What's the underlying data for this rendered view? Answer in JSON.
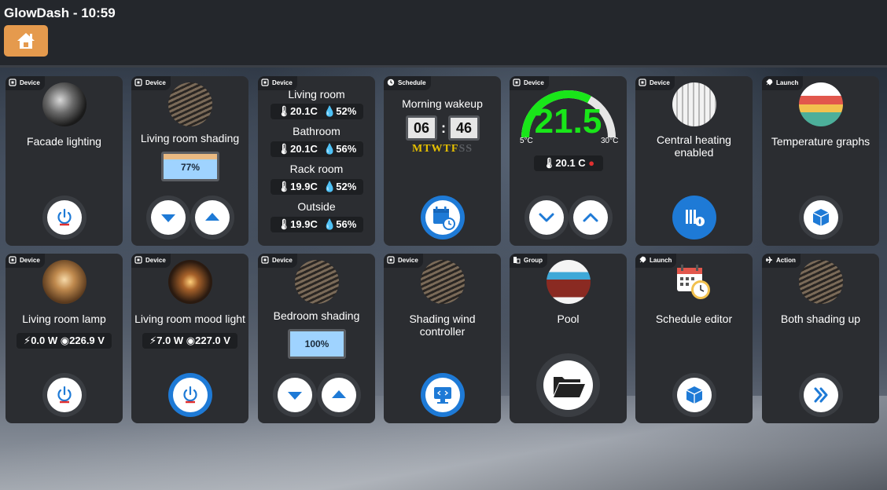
{
  "app": {
    "title": "GlowDash - 10:59"
  },
  "tags": {
    "device": "Device",
    "schedule": "Schedule",
    "launch": "Launch",
    "group": "Group",
    "action": "Action"
  },
  "tiles": {
    "facade": {
      "name": "Facade lighting"
    },
    "lr_shading": {
      "name": "Living room shading",
      "level": "77%"
    },
    "sensors": [
      {
        "room": "Living room",
        "temp": "20.1C",
        "hum": "52%"
      },
      {
        "room": "Bathroom",
        "temp": "20.1C",
        "hum": "56%"
      },
      {
        "room": "Rack room",
        "temp": "19.9C",
        "hum": "52%"
      },
      {
        "room": "Outside",
        "temp": "19.9C",
        "hum": "56%"
      }
    ],
    "morning": {
      "name": "Morning wakeup",
      "hour": "06",
      "sep": ":",
      "minute": "46",
      "days": [
        {
          "d": "M",
          "active": true
        },
        {
          "d": "T",
          "active": true
        },
        {
          "d": "W",
          "active": true
        },
        {
          "d": "T",
          "active": true
        },
        {
          "d": "F",
          "active": true
        },
        {
          "d": "S",
          "active": false
        },
        {
          "d": "S",
          "active": false
        }
      ]
    },
    "thermostat": {
      "value": "21.5",
      "min": "5°C",
      "max": "30°C",
      "current": "20.1 C",
      "fraction": 0.66
    },
    "heating": {
      "name": "Central heating enabled"
    },
    "tempgraphs": {
      "name": "Temperature graphs"
    },
    "lr_lamp": {
      "name": "Living room lamp",
      "power": "0.0 W",
      "voltage": "226.9 V"
    },
    "mood": {
      "name": "Living room mood light",
      "power": "7.0 W",
      "voltage": "227.0 V"
    },
    "bed_shading": {
      "name": "Bedroom shading",
      "level": "100%"
    },
    "wind": {
      "name": "Shading wind controller"
    },
    "pool": {
      "name": "Pool"
    },
    "schedule_editor": {
      "name": "Schedule editor"
    },
    "both_up": {
      "name": "Both shading up"
    }
  },
  "colors": {
    "accent": "#1e7ad6",
    "home": "#e59a4d",
    "gauge": "#19e619",
    "tile": "#2b2d31",
    "off": "#e03030"
  }
}
